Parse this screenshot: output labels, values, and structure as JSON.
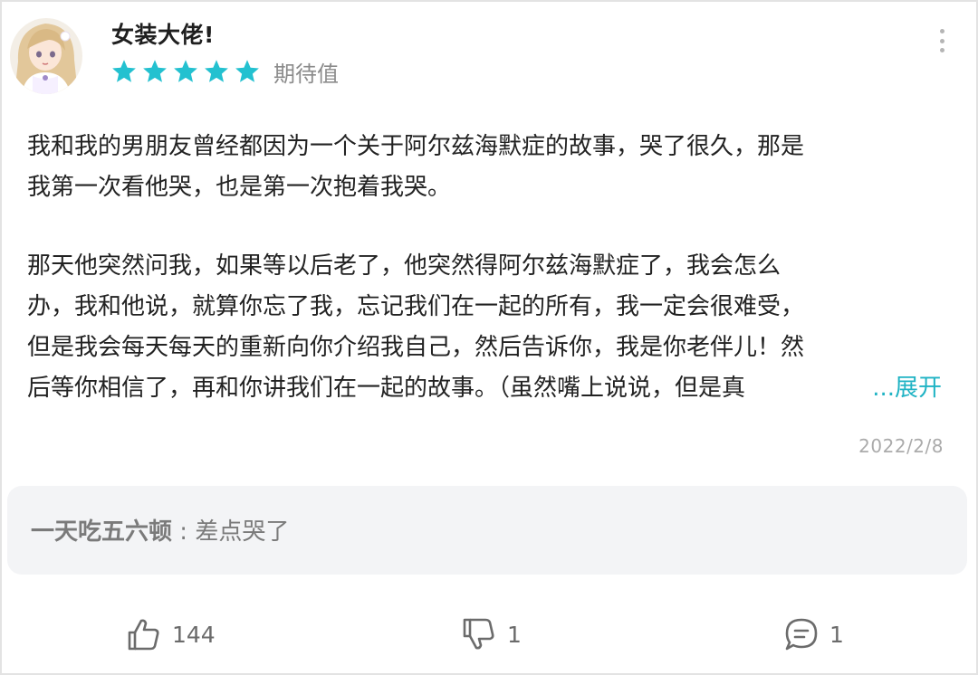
{
  "header": {
    "username": "女装大佬!",
    "rating_value": 5,
    "rating_max": 5,
    "rating_label": "期待值",
    "star_color": "#23c1d0",
    "more_icon": "more-vertical-icon"
  },
  "review": {
    "lines": [
      "我和我的男朋友曾经都因为一个关于阿尔兹海默症的故事，哭了很久，那是",
      "我第一次看他哭，也是第一次抱着我哭。",
      "那天他突然问我，如果等以后老了，他突然得阿尔兹海默症了，我会怎么",
      "办，我和他说，就算你忘了我，忘记我们在一起的所有，我一定会很难受，",
      "但是我会每天每天的重新向你介绍我自己，然后告诉你，我是你老伴儿！然",
      "后等你相信了，再和你讲我们在一起的故事。（虽然嘴上说说，但是真"
    ],
    "expand_label": "...展开",
    "date": "2022/2/8"
  },
  "reply": {
    "author": "一天吃五六顿",
    "separator": " : ",
    "text": "差点哭了"
  },
  "actions": {
    "like_count": "144",
    "dislike_count": "1",
    "comment_count": "1",
    "like_icon": "thumbs-up-icon",
    "dislike_icon": "thumbs-down-icon",
    "comment_icon": "comment-icon"
  },
  "colors": {
    "accent": "#1fb3c4",
    "icon_gray": "#6b6b6b"
  }
}
